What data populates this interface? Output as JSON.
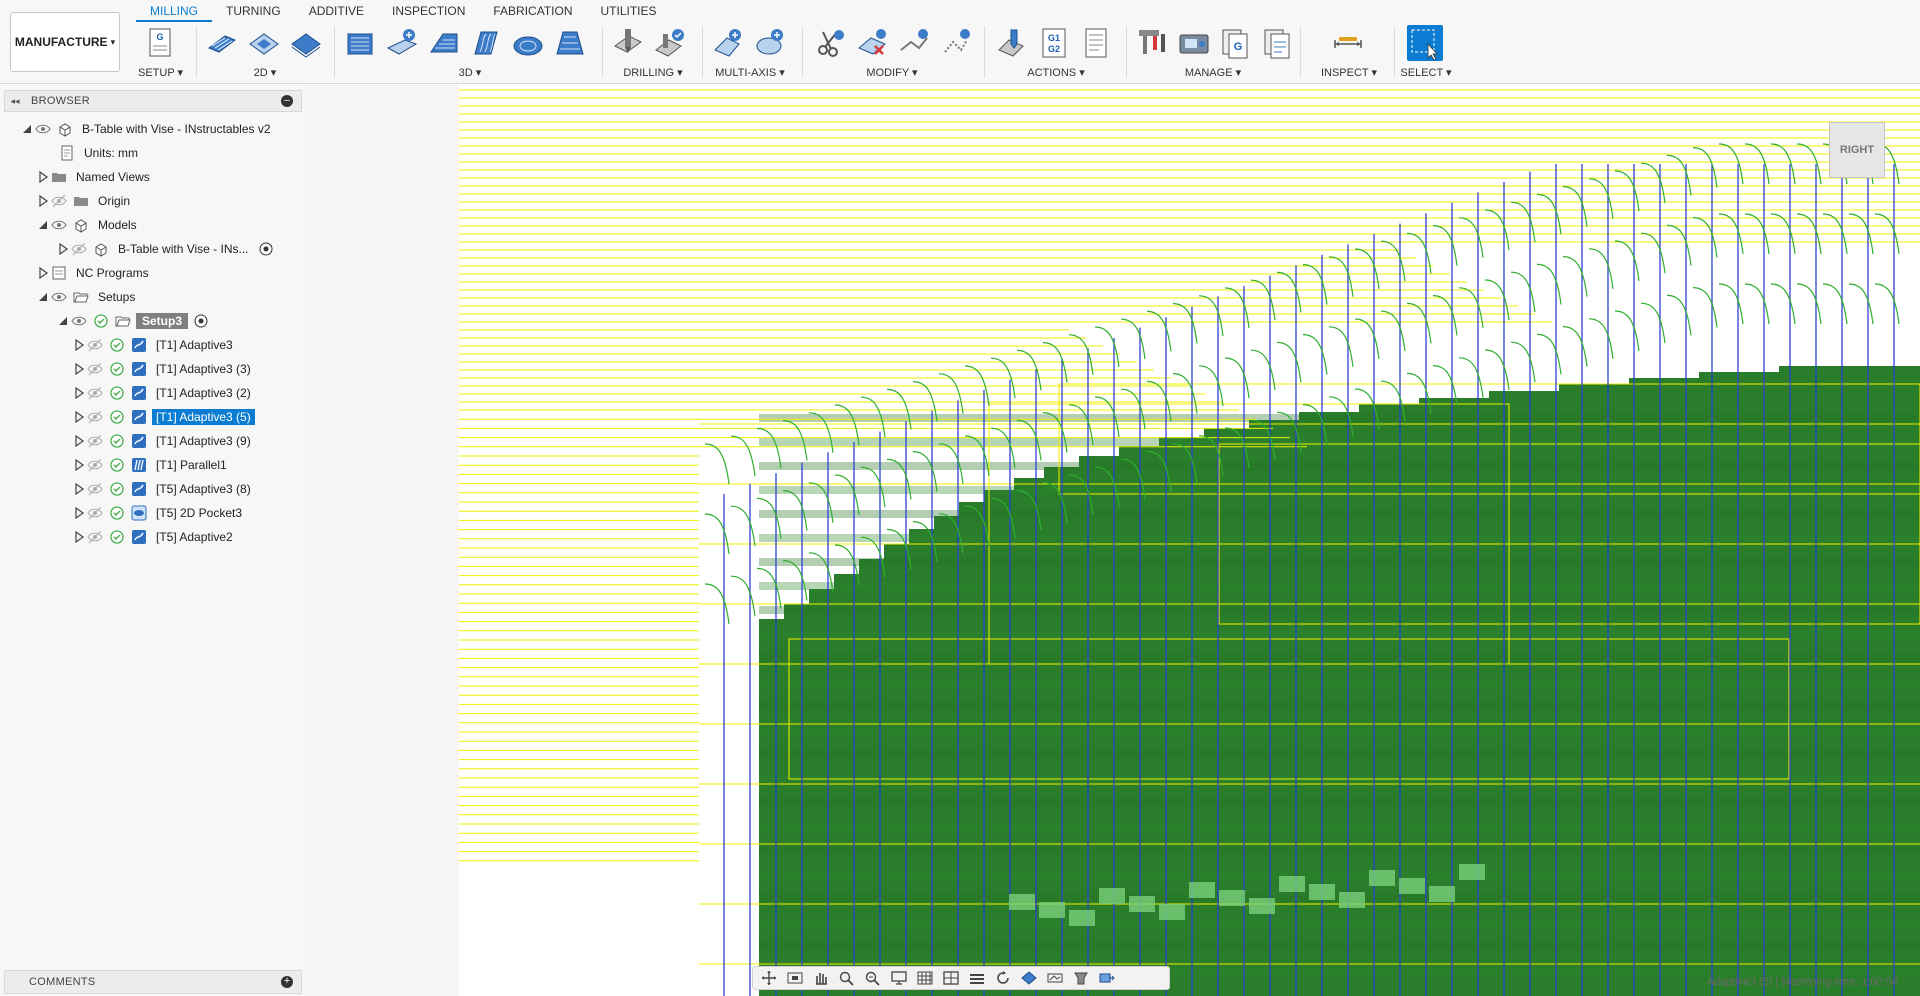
{
  "workspace": {
    "label": "MANUFACTURE",
    "caret": "▾"
  },
  "tabs": [
    {
      "label": "MILLING",
      "active": true
    },
    {
      "label": "TURNING"
    },
    {
      "label": "ADDITIVE"
    },
    {
      "label": "INSPECTION"
    },
    {
      "label": "FABRICATION"
    },
    {
      "label": "UTILITIES"
    }
  ],
  "toolbar_groups": {
    "setup": "SETUP ▾",
    "g2d": "2D ▾",
    "g3d": "3D ▾",
    "drilling": "DRILLING ▾",
    "multiaxis": "MULTI-AXIS ▾",
    "modify": "MODIFY ▾",
    "actions": "ACTIONS ▾",
    "manage": "MANAGE ▾",
    "inspect": "INSPECT ▾",
    "select": "SELECT ▾"
  },
  "toolbar_icon_text": {
    "setup_g": "G",
    "actions_g1": "G1",
    "actions_g2": "G2",
    "manage_g1": "G",
    "manage_g2": "G"
  },
  "browser": {
    "title": "BROWSER",
    "collapse": "◂◂",
    "minus": "–",
    "tree": {
      "root": "B-Table with Vise - INstructables v2",
      "units": "Units: mm",
      "named_views": "Named Views",
      "origin": "Origin",
      "models": "Models",
      "model_item": "B-Table with Vise - INs...",
      "nc_programs": "NC Programs",
      "setups": "Setups",
      "setup3": "Setup3",
      "operations": [
        "[T1] Adaptive3",
        "[T1] Adaptive3 (3)",
        "[T1] Adaptive3 (2)",
        "[T1] Adaptive3 (5)",
        "[T1] Adaptive3 (9)",
        "[T1] Parallel1",
        "[T5] Adaptive3 (8)",
        "[T5] 2D Pocket3",
        "[T5] Adaptive2"
      ],
      "selected_operation": 3
    }
  },
  "comments": {
    "title": "COMMENTS",
    "plus": "+"
  },
  "viewcube": {
    "face": "RIGHT"
  },
  "status": "Adaptive3 (5) | Machining time: 1:00:54",
  "colors": {
    "accent": "#0a7cd1",
    "toolpath_yellow": "#f0f000",
    "toolpath_green": "#2fae2f",
    "plunge_blue": "#2b3fd6",
    "stock_green": "#2a7d2a"
  }
}
